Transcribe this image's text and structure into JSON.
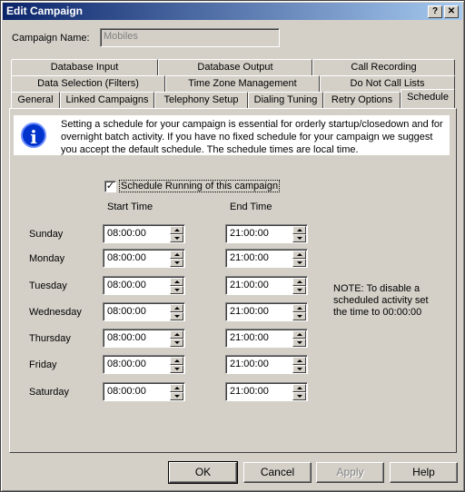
{
  "window": {
    "title": "Edit Campaign",
    "help_btn": "?",
    "close_btn": "✕"
  },
  "campaign": {
    "label": "Campaign Name:",
    "value": "Mobiles"
  },
  "tabs": {
    "row1": [
      "Database Input",
      "Database Output",
      "Call Recording"
    ],
    "row2": [
      "Data Selection (Filters)",
      "Time Zone Management",
      "Do Not Call Lists"
    ],
    "row3": [
      "General",
      "Linked Campaigns",
      "Telephony Setup",
      "Dialing Tuning",
      "Retry Options",
      "Schedule"
    ]
  },
  "info": {
    "icon": "i",
    "text": "Setting a schedule for your campaign is essential for orderly startup/closedown and for overnight batch activity. If you have no fixed schedule for your campaign we suggest you accept the default schedule. The schedule times are local time."
  },
  "schedule": {
    "checkbox_label": "Schedule Running of this campaign",
    "checked_mark": "✓",
    "start_header": "Start Time",
    "end_header": "End Time",
    "days": [
      {
        "name": "Sunday",
        "start": "08:00:00",
        "end": "21:00:00"
      },
      {
        "name": "Monday",
        "start": "08:00:00",
        "end": "21:00:00"
      },
      {
        "name": "Tuesday",
        "start": "08:00:00",
        "end": "21:00:00"
      },
      {
        "name": "Wednesday",
        "start": "08:00:00",
        "end": "21:00:00"
      },
      {
        "name": "Thursday",
        "start": "08:00:00",
        "end": "21:00:00"
      },
      {
        "name": "Friday",
        "start": "08:00:00",
        "end": "21:00:00"
      },
      {
        "name": "Saturday",
        "start": "08:00:00",
        "end": "21:00:00"
      }
    ],
    "note": "NOTE: To disable a scheduled activity set the time to 00:00:00"
  },
  "buttons": {
    "ok": "OK",
    "cancel": "Cancel",
    "apply": "Apply",
    "help": "Help"
  }
}
